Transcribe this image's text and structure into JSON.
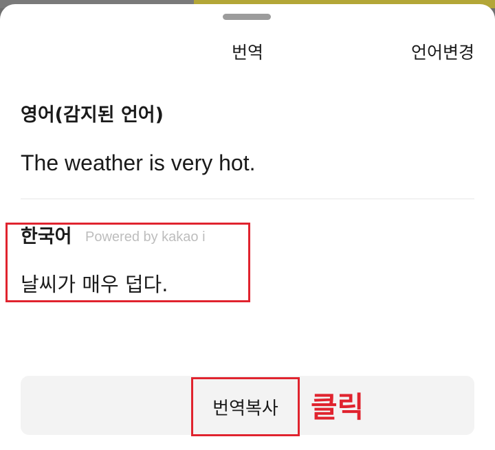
{
  "header": {
    "title": "번역",
    "language_change_label": "언어변경"
  },
  "source": {
    "language_label": "영어(감지된 언어)",
    "text": "The weather is very hot."
  },
  "target": {
    "language_label": "한국어",
    "powered_by": "Powered by kakao i",
    "text": "날씨가 매우 덥다."
  },
  "actions": {
    "copy_translation_label": "번역복사"
  },
  "annotation": {
    "click_label": "클릭"
  },
  "colors": {
    "highlight": "#e0232e",
    "top_accent": "#b3a637"
  }
}
